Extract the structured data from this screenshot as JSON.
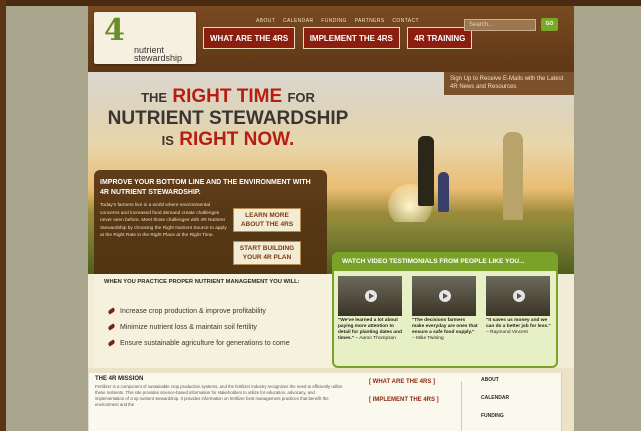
{
  "brand": {
    "mark": "4",
    "name_line1": "nutrient",
    "name_line2": "stewardship"
  },
  "topnav": [
    "ABOUT",
    "CALENDAR",
    "FUNDING",
    "PARTNERS",
    "CONTACT"
  ],
  "tabs": [
    "WHAT ARE THE 4RS",
    "IMPLEMENT THE 4RS",
    "4R TRAINING"
  ],
  "search": {
    "placeholder": "Search...",
    "button": "GO"
  },
  "signup": "Sign Up to Receive E-Mails with the Latest 4R News and Resources",
  "headline": {
    "line1_small": "THE",
    "line1_red": "RIGHT TIME",
    "line1_tail": "FOR",
    "line2": "NUTRIENT STEWARDSHIP",
    "line3_small": "IS",
    "line3_red": "RIGHT NOW."
  },
  "panel": {
    "heading": "IMPROVE YOUR BOTTOM LINE AND THE ENVIRONMENT WITH 4R NUTRIENT STEWARDSHIP.",
    "body": "Today's farmers live in a world where environmental concerns and increased food demand create challenges never seen before. Meet those challenges with 4R Nutrient Stewardship by choosing the Right Nutrient Source to apply at the Right Rate in the Right Place at the Right Time.",
    "btn_learn": "LEARN MORE ABOUT THE 4RS",
    "btn_plan": "START BUILDING YOUR 4R PLAN"
  },
  "practice": {
    "heading": "WHEN YOU PRACTICE PROPER NUTRIENT MANAGEMENT YOU WILL:",
    "items": [
      "Increase crop production & improve profitability",
      "Minimize nutrient loss & maintain soil fertility",
      "Ensure sustainable agriculture for generations to come"
    ]
  },
  "video": {
    "heading": "WATCH VIDEO TESTIMONIALS FROM PEOPLE LIKE YOU...",
    "quotes": [
      {
        "text": "\"We've learned a lot about paying more attention to detail for planting dates and times.\"",
        "who": "– Aaron Thompson"
      },
      {
        "text": "\"The decisions farmers make everyday are ones that ensure a safe food supply.\"",
        "who": "– Mike Twining"
      },
      {
        "text": "\"It saves us money and we can do a better job for less.\"",
        "who": "– Raymond Vincent"
      }
    ]
  },
  "footer": {
    "mission_title": "THE 4R MISSION",
    "mission_body": "Fertilizer is a component of sustainable crop production systems, and the fertilizer industry recognizes the need to efficiently utilize these nutrients. This site provides science-based information for stakeholders to utilize for education, advocacy, and implementation of crop nutrient stewardship. It provides information on fertilizer best management practices that benefit the environment and the",
    "links": [
      "[ WHAT ARE THE 4RS ]",
      "[ IMPLEMENT THE 4RS ]"
    ],
    "nav": [
      "ABOUT",
      "CALENDAR",
      "FUNDING"
    ]
  }
}
